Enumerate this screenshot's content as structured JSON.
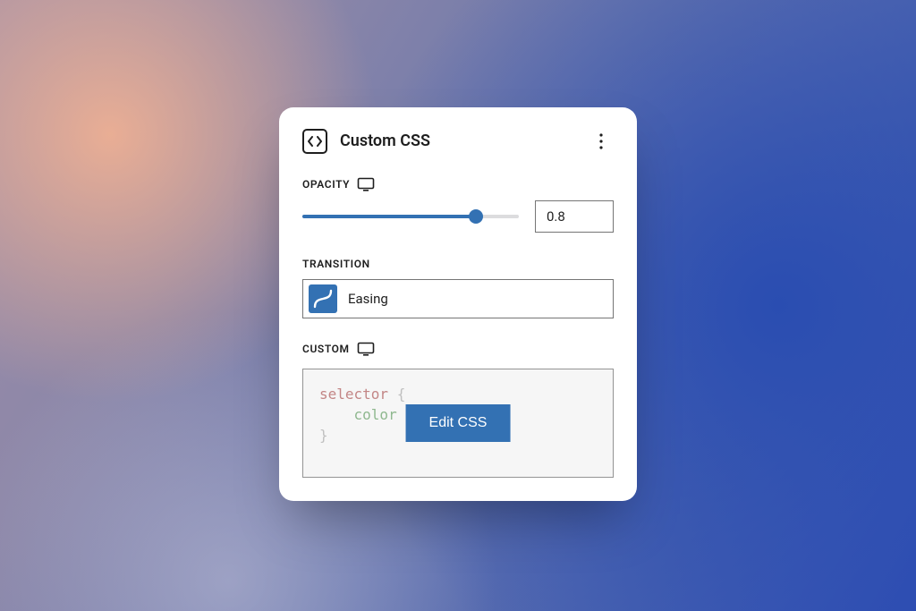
{
  "panel": {
    "title": "Custom CSS"
  },
  "opacity": {
    "label": "OPACITY",
    "value": "0.8",
    "percent": 80
  },
  "transition": {
    "label": "TRANSITION",
    "value": "Easing"
  },
  "custom": {
    "label": "CUSTOM",
    "code": {
      "selector": "selector",
      "brace_open": " {",
      "indent": "    ",
      "prop": "color",
      "brace_close": "}"
    },
    "edit_button": "Edit CSS"
  },
  "colors": {
    "accent": "#3371b3"
  }
}
